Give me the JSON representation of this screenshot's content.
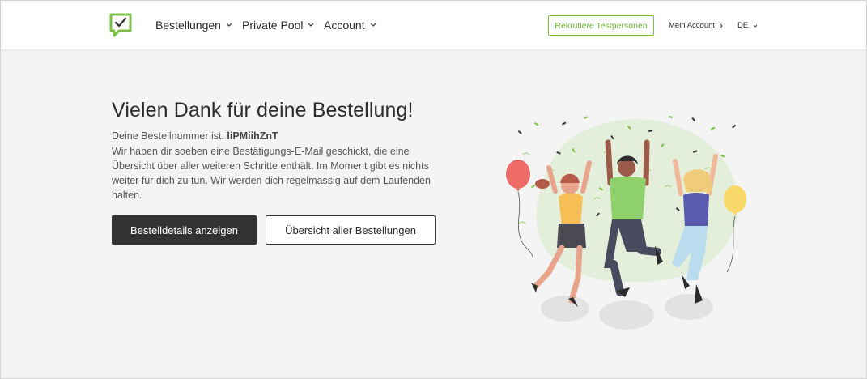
{
  "header": {
    "nav": [
      {
        "label": "Bestellungen"
      },
      {
        "label": "Private Pool"
      },
      {
        "label": "Account"
      }
    ],
    "recruit_label": "Rekrutiere Testpersonen",
    "account_label": "Mein Account",
    "language": "DE"
  },
  "main": {
    "title": "Vielen Dank für deine Bestellung!",
    "order_prefix": "Deine Bestellnummer ist: ",
    "order_number": "liPMiihZnT",
    "description": "Wir haben dir soeben eine Bestätigungs-E-Mail geschickt, die eine Übersicht über aller weiteren Schritte enthält. Im Moment gibt es nichts weiter für dich zu tun. Wir werden dich regelmässig auf dem Laufenden halten.",
    "primary_button": "Bestelldetails anzeigen",
    "secondary_button": "Übersicht aller Bestellungen"
  },
  "colors": {
    "brand_green": "#7cc242",
    "dark_button": "#333333",
    "background": "#f4f4f4"
  }
}
